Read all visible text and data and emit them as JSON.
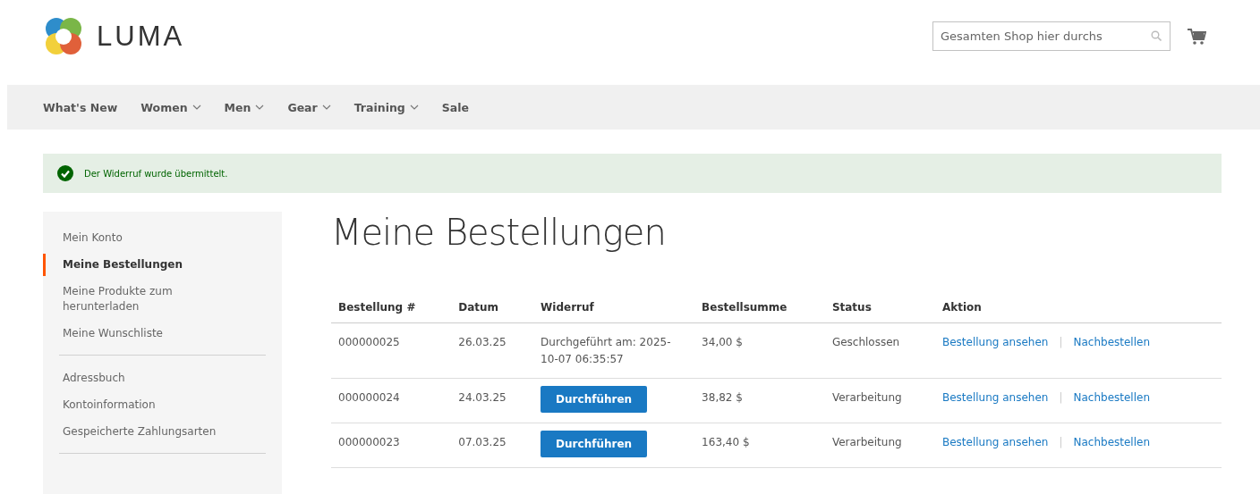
{
  "header": {
    "logo_text": "LUMA",
    "search": {
      "placeholder": "Gesamten Shop hier durchs"
    }
  },
  "nav": [
    {
      "label": "What's New",
      "dropdown": false
    },
    {
      "label": "Women",
      "dropdown": true
    },
    {
      "label": "Men",
      "dropdown": true
    },
    {
      "label": "Gear",
      "dropdown": true
    },
    {
      "label": "Training",
      "dropdown": true
    },
    {
      "label": "Sale",
      "dropdown": false
    }
  ],
  "message": {
    "kind": "success",
    "text": "Der Widerruf wurde übermittelt."
  },
  "sidebar": {
    "groups": [
      [
        {
          "label": "Mein Konto",
          "selected": false
        },
        {
          "label": "Meine Bestellungen",
          "selected": true
        },
        {
          "label": "Meine Produkte zum herunterladen",
          "selected": false
        },
        {
          "label": "Meine Wunschliste",
          "selected": false
        }
      ],
      [
        {
          "label": "Adressbuch",
          "selected": false
        },
        {
          "label": "Kontoinformation",
          "selected": false
        },
        {
          "label": "Gespeicherte Zahlungsarten",
          "selected": false
        }
      ]
    ]
  },
  "page_title": "Meine Bestellungen",
  "table": {
    "columns": [
      "Bestellung #",
      "Datum",
      "Widerruf",
      "Bestellsumme",
      "Status",
      "Aktion"
    ],
    "rows": [
      {
        "order": "000000025",
        "date": "26.03.25",
        "withdrawal": {
          "kind": "done",
          "text": "Durchgeführt am: 2025-10-07 06:35:57"
        },
        "total": "34,00 $",
        "status": "Geschlossen",
        "actions": [
          "Bestellung ansehen",
          "Nachbestellen"
        ],
        "separator": "|"
      },
      {
        "order": "000000024",
        "date": "24.03.25",
        "withdrawal": {
          "kind": "button",
          "text": "Durchführen"
        },
        "total": "38,82 $",
        "status": "Verarbeitung",
        "actions": [
          "Bestellung ansehen",
          "Nachbestellen"
        ],
        "separator": "|"
      },
      {
        "order": "000000023",
        "date": "07.03.25",
        "withdrawal": {
          "kind": "button",
          "text": "Durchführen"
        },
        "total": "163,40 $",
        "status": "Verarbeitung",
        "actions": [
          "Bestellung ansehen",
          "Nachbestellen"
        ],
        "separator": "|"
      }
    ]
  }
}
